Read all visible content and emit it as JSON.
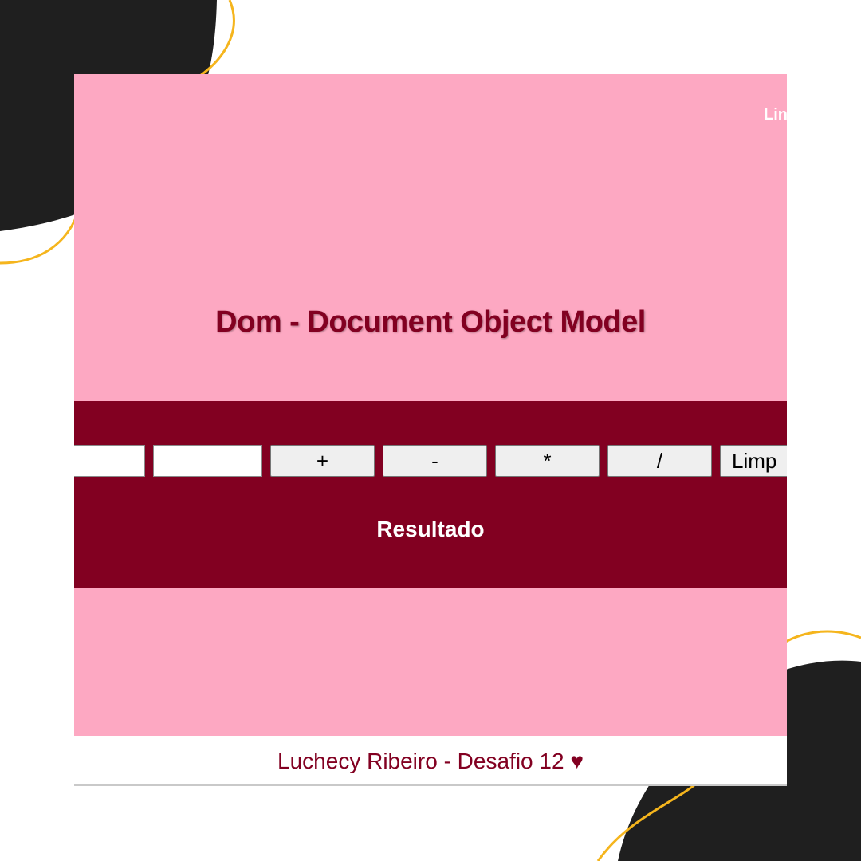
{
  "header": {
    "top_link": "Lin"
  },
  "page": {
    "title": "Dom - Document Object Model"
  },
  "calculator": {
    "input_one": {
      "value": "",
      "placeholder": ""
    },
    "input_two": {
      "value": "",
      "placeholder": ""
    },
    "buttons": {
      "add": "+",
      "subtract": "-",
      "multiply": "*",
      "divide": "/",
      "clear": "Limp"
    },
    "result_label": "Resultado"
  },
  "footer": {
    "credit": "Luchecy Ribeiro - Desafio 12 ♥"
  },
  "colors": {
    "page_background": "#fda8c2",
    "accent": "#820021",
    "decor_blob": "#1f1f1f",
    "decor_line": "#f5b51d"
  }
}
